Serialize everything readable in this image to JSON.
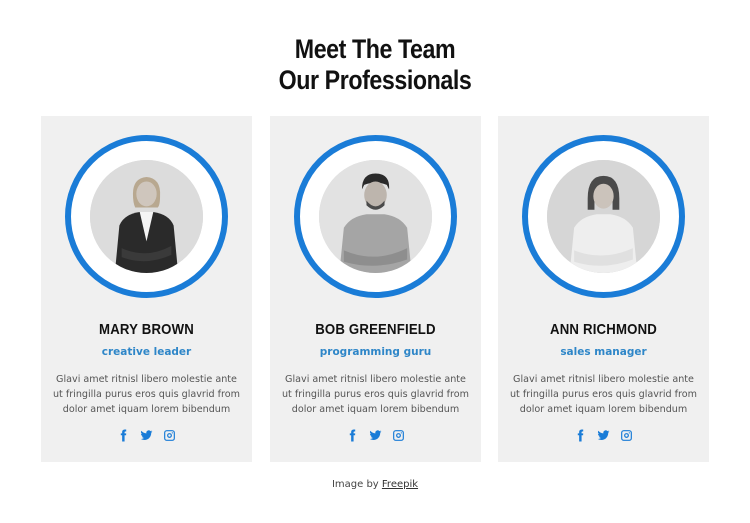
{
  "heading": {
    "line1": "Meet The Team",
    "line2": "Our Professionals"
  },
  "colors": {
    "accent": "#1a7cd7",
    "role_text": "#2e86c8",
    "card_bg": "#f0f0f0"
  },
  "team": [
    {
      "name": "MARY BROWN",
      "role": "creative leader",
      "description": "Glavi amet ritnisl libero molestie ante ut fringilla purus eros quis glavrid from dolor amet iquam lorem bibendum",
      "photo": "woman-in-blazer-portrait",
      "social": [
        "facebook-icon",
        "twitter-icon",
        "instagram-icon"
      ]
    },
    {
      "name": "BOB GREENFIELD",
      "role": "programming guru",
      "description": "Glavi amet ritnisl libero molestie ante ut fringilla purus eros quis glavrid from dolor amet iquam lorem bibendum",
      "photo": "bearded-man-portrait",
      "social": [
        "facebook-icon",
        "twitter-icon",
        "instagram-icon"
      ]
    },
    {
      "name": "ANN RICHMOND",
      "role": "sales manager",
      "description": "Glavi amet ritnisl libero molestie ante ut fringilla purus eros quis glavrid from dolor amet iquam lorem bibendum",
      "photo": "woman-in-sweater-portrait",
      "social": [
        "facebook-icon",
        "twitter-icon",
        "instagram-icon"
      ]
    }
  ],
  "credit": {
    "prefix": "Image by",
    "link": "Freepik"
  }
}
